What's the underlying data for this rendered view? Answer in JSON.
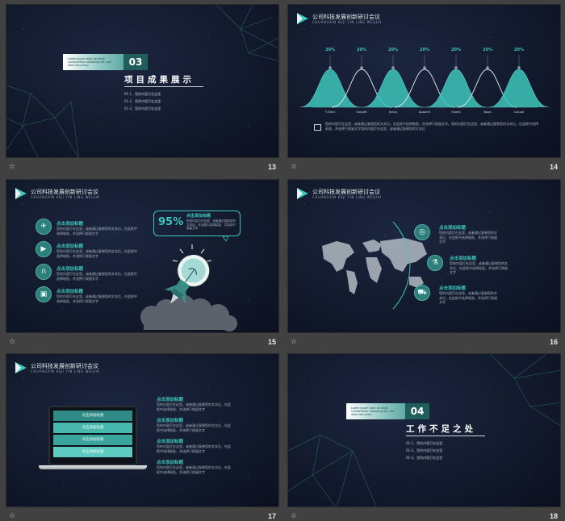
{
  "slides": [
    {
      "number": "13",
      "star": "☆",
      "section_number": "03",
      "section_small": "Lorem ipsum dolor sit amet, consectetuer adipiscing elit, sed diam nonummy",
      "section_title": "项目成果展示",
      "items": [
        "01-1、您的内容打在这里",
        "01-2、您的内容打在这里",
        "01-3、您的内容打在这里"
      ]
    },
    {
      "number": "14",
      "star": "☆",
      "header_title": "公司科技发展创新研讨会议",
      "header_sub": "CHUANGXIN  KEJI  YIN  LING  WEIJIAI",
      "body_text": "您的内容打在这里，或者通过复制您的文本后，在此框中选择粘贴，并选择只保留文字。您的内容打在这里，或者通过复制您的文本后，在此框中选择粘贴，并选择只保留文字您的内容打在这里，或者通过复制您的文本后"
    },
    {
      "number": "15",
      "star": "☆",
      "header_title": "公司科技发展创新研讨会议",
      "header_sub": "CHUANGXIN  KEJI  YIN  LING  WEIJIAI",
      "list_items": [
        {
          "icon": "send-icon",
          "title": "点击添加标题",
          "text": "您的内容打在这里，或者通过复制您的文本后，在此框中选择粘贴，并选择只保留文字"
        },
        {
          "icon": "play-icon",
          "title": "点击添加标题",
          "text": "您的内容打在这里，或者通过复制您的文本后，在此框中选择粘贴，并选择只保留文字"
        },
        {
          "icon": "headphones-icon",
          "title": "点击添加标题",
          "text": "您的内容打在这里，或者通过复制您的文本后，在此框中选择粘贴，并选择只保留文字"
        },
        {
          "icon": "ticket-icon",
          "title": "点击添加标题",
          "text": "您的内容打在这里，或者通过复制您的文本后，在此框中选择粘贴，并选择只保留文字"
        }
      ],
      "bubble_value": "95%",
      "bubble_title": "点击添加标题",
      "bubble_text": "您的内容打在这里，或者通过复制您的文本后，在此框中选择粘贴，并选择只保留文字"
    },
    {
      "number": "16",
      "star": "☆",
      "header_title": "公司科技发展创新研讨会议",
      "header_sub": "CHUANGXIN  KEJI  YIN  LING  WEIJIAI",
      "points": [
        {
          "icon": "globe-icon",
          "title": "点击添加标题",
          "text": "您的内容打在这里，或者通过复制您的文本后，在此框中选择粘贴，并选择只保留文字"
        },
        {
          "icon": "flask-icon",
          "title": "点击添加标题",
          "text": "您的内容打在这里，或者通过复制您的文本后，在此框中选择粘贴，并选择只保留文字"
        },
        {
          "icon": "cart-icon",
          "title": "点击添加标题",
          "text": "您的内容打在这里，或者通过复制您的文本后，在此框中选择粘贴，并选择只保留文字"
        }
      ]
    },
    {
      "number": "17",
      "star": "☆",
      "header_title": "公司科技发展创新研讨会议",
      "header_sub": "CHUANGXIN  KEJI  YIN  LING  WEIJIAI",
      "screen_rows": [
        "点击添加标题",
        "点击添加标题",
        "点击添加标题",
        "点击添加标题"
      ],
      "points": [
        {
          "title": "点击添加标题",
          "text": "您的内容打在这里，或者通过复制您的文本后，在此框中选择粘贴，并选择只保留文字"
        },
        {
          "title": "点击添加标题",
          "text": "您的内容打在这里，或者通过复制您的文本后，在此框中选择粘贴，并选择只保留文字"
        },
        {
          "title": "点击添加标题",
          "text": "您的内容打在这里，或者通过复制您的文本后，在此框中选择粘贴，并选择只保留文字"
        },
        {
          "title": "点击添加标题",
          "text": "您的内容打在这里，或者通过复制您的文本后，在此框中选择粘贴，并选择只保留文字"
        }
      ]
    },
    {
      "number": "18",
      "star": "☆",
      "section_number": "04",
      "section_small": "Lorem ipsum dolor sit amet, consectetuer adipiscing elit, sed diam nonummy",
      "section_title": "工作不足之处",
      "items": [
        "01-1、您的内容打在这里",
        "01-2、您的内容打在这里",
        "01-3、您的内容打在这里"
      ]
    }
  ],
  "chart_data": {
    "type": "area",
    "categories": [
      "T-Shirt",
      "Singlet",
      "Jeans",
      "Apparel",
      "Shoes",
      "Bags",
      "Casual"
    ],
    "labels": [
      "20%",
      "20%",
      "20%",
      "20%",
      "20%",
      "20%",
      "20%"
    ],
    "series": [
      {
        "values": [
          20,
          null,
          20,
          null,
          20,
          null,
          20
        ]
      },
      {
        "values": [
          null,
          20,
          null,
          20,
          null,
          20,
          null
        ]
      }
    ]
  },
  "colors": {
    "accent": "#3ec6bb",
    "accent_dark": "#1f5e5b",
    "slide_bg": "#121a2d",
    "app_bg": "#414141"
  }
}
